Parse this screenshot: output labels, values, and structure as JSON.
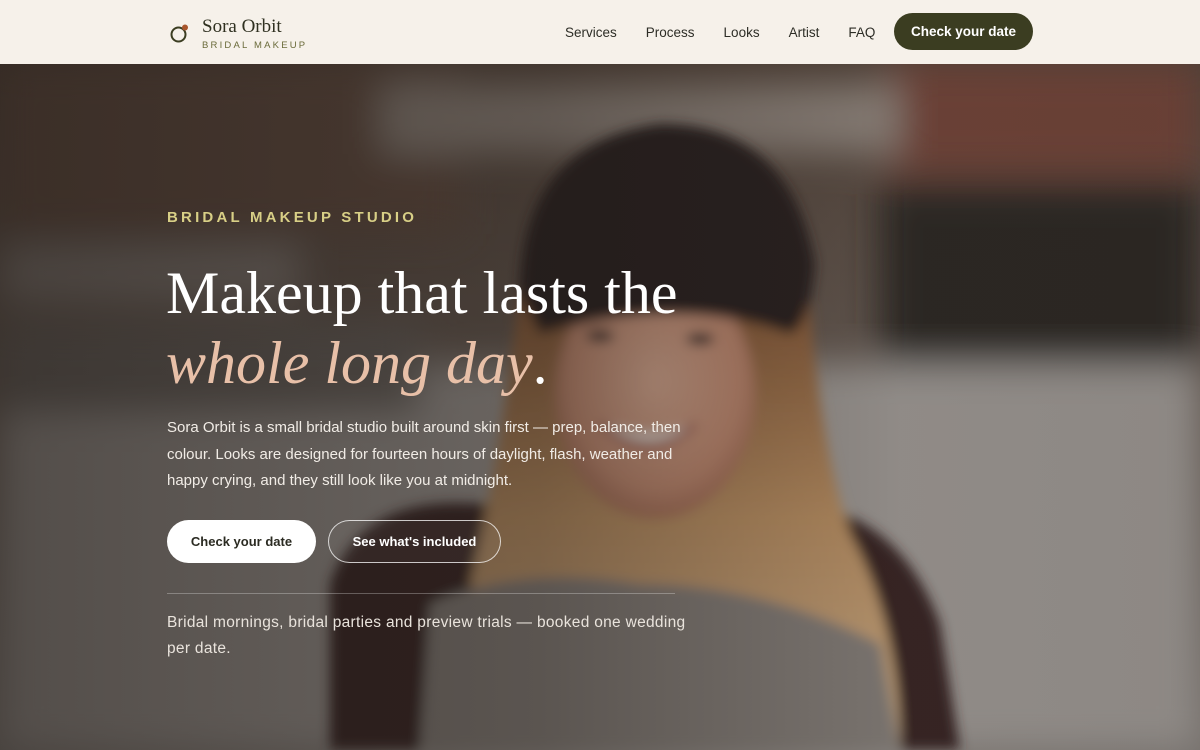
{
  "header": {
    "brand_name": "Sora Orbit",
    "brand_sub": "BRIDAL MAKEUP",
    "nav": [
      {
        "label": "Services"
      },
      {
        "label": "Process"
      },
      {
        "label": "Looks"
      },
      {
        "label": "Artist"
      },
      {
        "label": "FAQ"
      }
    ],
    "cta_label": "Check your date"
  },
  "hero": {
    "eyebrow": "BRIDAL MAKEUP STUDIO",
    "headline_line1": "Makeup that lasts the",
    "headline_accent": "whole long day",
    "headline_end": ".",
    "intro": "Sora Orbit is a small bridal studio built around skin first — prep, balance, then colour. Looks are designed for fourteen hours of daylight, flash, weather and happy crying, and they still look like you at midnight.",
    "primary_button": "Check your date",
    "secondary_button": "See what's included",
    "footnote": "Bridal mornings, bridal parties and preview trials — booked one wedding per date."
  },
  "colors": {
    "header_bg": "#f6f1ea",
    "brand_dark": "#3b3d21",
    "eyebrow": "#d8cf86",
    "accent_text": "#e8c0a8"
  },
  "icons": {
    "logo": "ring-logo-icon"
  }
}
